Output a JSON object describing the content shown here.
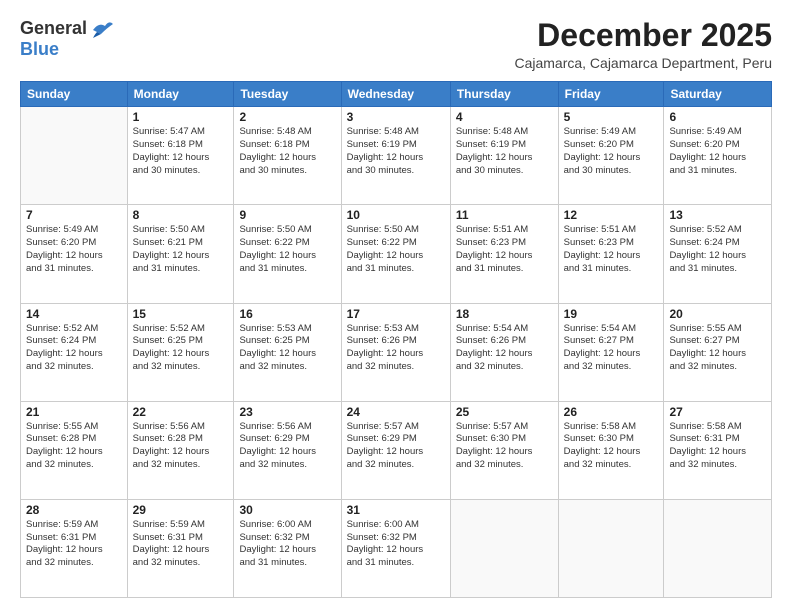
{
  "logo": {
    "general": "General",
    "blue": "Blue"
  },
  "title": "December 2025",
  "subtitle": "Cajamarca, Cajamarca Department, Peru",
  "days_header": [
    "Sunday",
    "Monday",
    "Tuesday",
    "Wednesday",
    "Thursday",
    "Friday",
    "Saturday"
  ],
  "weeks": [
    [
      {
        "day": "",
        "info": ""
      },
      {
        "day": "1",
        "info": "Sunrise: 5:47 AM\nSunset: 6:18 PM\nDaylight: 12 hours\nand 30 minutes."
      },
      {
        "day": "2",
        "info": "Sunrise: 5:48 AM\nSunset: 6:18 PM\nDaylight: 12 hours\nand 30 minutes."
      },
      {
        "day": "3",
        "info": "Sunrise: 5:48 AM\nSunset: 6:19 PM\nDaylight: 12 hours\nand 30 minutes."
      },
      {
        "day": "4",
        "info": "Sunrise: 5:48 AM\nSunset: 6:19 PM\nDaylight: 12 hours\nand 30 minutes."
      },
      {
        "day": "5",
        "info": "Sunrise: 5:49 AM\nSunset: 6:20 PM\nDaylight: 12 hours\nand 30 minutes."
      },
      {
        "day": "6",
        "info": "Sunrise: 5:49 AM\nSunset: 6:20 PM\nDaylight: 12 hours\nand 31 minutes."
      }
    ],
    [
      {
        "day": "7",
        "info": "Sunrise: 5:49 AM\nSunset: 6:20 PM\nDaylight: 12 hours\nand 31 minutes."
      },
      {
        "day": "8",
        "info": "Sunrise: 5:50 AM\nSunset: 6:21 PM\nDaylight: 12 hours\nand 31 minutes."
      },
      {
        "day": "9",
        "info": "Sunrise: 5:50 AM\nSunset: 6:22 PM\nDaylight: 12 hours\nand 31 minutes."
      },
      {
        "day": "10",
        "info": "Sunrise: 5:50 AM\nSunset: 6:22 PM\nDaylight: 12 hours\nand 31 minutes."
      },
      {
        "day": "11",
        "info": "Sunrise: 5:51 AM\nSunset: 6:23 PM\nDaylight: 12 hours\nand 31 minutes."
      },
      {
        "day": "12",
        "info": "Sunrise: 5:51 AM\nSunset: 6:23 PM\nDaylight: 12 hours\nand 31 minutes."
      },
      {
        "day": "13",
        "info": "Sunrise: 5:52 AM\nSunset: 6:24 PM\nDaylight: 12 hours\nand 31 minutes."
      }
    ],
    [
      {
        "day": "14",
        "info": "Sunrise: 5:52 AM\nSunset: 6:24 PM\nDaylight: 12 hours\nand 32 minutes."
      },
      {
        "day": "15",
        "info": "Sunrise: 5:52 AM\nSunset: 6:25 PM\nDaylight: 12 hours\nand 32 minutes."
      },
      {
        "day": "16",
        "info": "Sunrise: 5:53 AM\nSunset: 6:25 PM\nDaylight: 12 hours\nand 32 minutes."
      },
      {
        "day": "17",
        "info": "Sunrise: 5:53 AM\nSunset: 6:26 PM\nDaylight: 12 hours\nand 32 minutes."
      },
      {
        "day": "18",
        "info": "Sunrise: 5:54 AM\nSunset: 6:26 PM\nDaylight: 12 hours\nand 32 minutes."
      },
      {
        "day": "19",
        "info": "Sunrise: 5:54 AM\nSunset: 6:27 PM\nDaylight: 12 hours\nand 32 minutes."
      },
      {
        "day": "20",
        "info": "Sunrise: 5:55 AM\nSunset: 6:27 PM\nDaylight: 12 hours\nand 32 minutes."
      }
    ],
    [
      {
        "day": "21",
        "info": "Sunrise: 5:55 AM\nSunset: 6:28 PM\nDaylight: 12 hours\nand 32 minutes."
      },
      {
        "day": "22",
        "info": "Sunrise: 5:56 AM\nSunset: 6:28 PM\nDaylight: 12 hours\nand 32 minutes."
      },
      {
        "day": "23",
        "info": "Sunrise: 5:56 AM\nSunset: 6:29 PM\nDaylight: 12 hours\nand 32 minutes."
      },
      {
        "day": "24",
        "info": "Sunrise: 5:57 AM\nSunset: 6:29 PM\nDaylight: 12 hours\nand 32 minutes."
      },
      {
        "day": "25",
        "info": "Sunrise: 5:57 AM\nSunset: 6:30 PM\nDaylight: 12 hours\nand 32 minutes."
      },
      {
        "day": "26",
        "info": "Sunrise: 5:58 AM\nSunset: 6:30 PM\nDaylight: 12 hours\nand 32 minutes."
      },
      {
        "day": "27",
        "info": "Sunrise: 5:58 AM\nSunset: 6:31 PM\nDaylight: 12 hours\nand 32 minutes."
      }
    ],
    [
      {
        "day": "28",
        "info": "Sunrise: 5:59 AM\nSunset: 6:31 PM\nDaylight: 12 hours\nand 32 minutes."
      },
      {
        "day": "29",
        "info": "Sunrise: 5:59 AM\nSunset: 6:31 PM\nDaylight: 12 hours\nand 32 minutes."
      },
      {
        "day": "30",
        "info": "Sunrise: 6:00 AM\nSunset: 6:32 PM\nDaylight: 12 hours\nand 31 minutes."
      },
      {
        "day": "31",
        "info": "Sunrise: 6:00 AM\nSunset: 6:32 PM\nDaylight: 12 hours\nand 31 minutes."
      },
      {
        "day": "",
        "info": ""
      },
      {
        "day": "",
        "info": ""
      },
      {
        "day": "",
        "info": ""
      }
    ]
  ]
}
